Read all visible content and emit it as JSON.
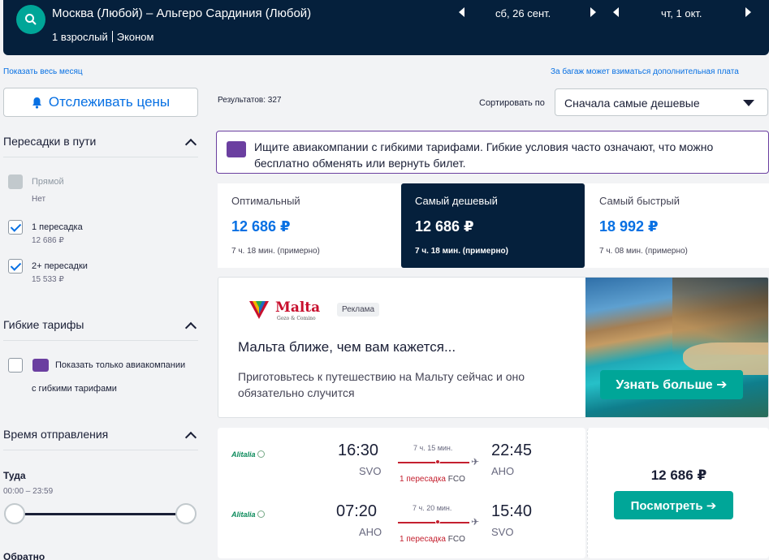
{
  "header": {
    "route": "Москва (Любой) – Альгеро Сардиния (Любой)",
    "passengers": "1 взрослый",
    "cabin": "Эконом",
    "depart_date": "сб, 26 сент.",
    "return_date": "чт, 1 окт."
  },
  "links": {
    "whole_month": "Показать весь месяц",
    "baggage": "За багаж может взиматься дополнительная плата"
  },
  "sidebar": {
    "track_label": "Отслеживать цены",
    "stops": {
      "title": "Пересадки в пути",
      "options": [
        {
          "label": "Прямой",
          "sub": "Нет",
          "checked": false,
          "disabled": true
        },
        {
          "label": "1 пересадка",
          "sub": "12 686 ₽",
          "checked": true,
          "disabled": false
        },
        {
          "label": "2+ пересадки",
          "sub": "15 533 ₽",
          "checked": true,
          "disabled": false
        }
      ]
    },
    "flex": {
      "title": "Гибкие тарифы",
      "option_line1": "Показать только авиакомпании",
      "option_line2": "с гибкими тарифами"
    },
    "departure": {
      "title": "Время отправления",
      "outbound_label": "Туда",
      "outbound_range": "00:00 – 23:59",
      "return_label": "Обратно"
    }
  },
  "main": {
    "results": "Результатов: 327",
    "sort_label": "Сортировать по",
    "sort_value": "Сначала самые дешевые",
    "flex_banner": "Ищите авиакомпании с гибкими тарифами. Гибкие условия часто означают, что можно бесплатно обменять или вернуть билет.",
    "tabs": [
      {
        "label": "Оптимальный",
        "price": "12 686 ₽",
        "time": "7 ч. 18 мин. (примерно)",
        "active": false
      },
      {
        "label": "Самый дешевый",
        "price": "12 686 ₽",
        "time": "7 ч. 18 мин. (примерно)",
        "active": true
      },
      {
        "label": "Самый быстрый",
        "price": "18 992 ₽",
        "time": "7 ч. 08 мин. (примерно)",
        "active": false
      }
    ],
    "ad": {
      "brand": "Malta",
      "brand_sub": "Gozo & Comino",
      "badge": "Реклама",
      "headline": "Мальта ближе, чем вам кажется...",
      "desc": "Приготовьтесь к путешествию на Мальту сейчас и оно обязательно случится",
      "cta": "Узнать больше ➔"
    },
    "ticket": {
      "price": "12 686 ₽",
      "button": "Посмотреть ➔",
      "legs": [
        {
          "airline": "Alitalia",
          "dep_time": "16:30",
          "dep_code": "SVO",
          "duration": "7 ч. 15 мин.",
          "stops": "1 пересадка",
          "via": "FCO",
          "arr_time": "22:45",
          "arr_code": "AHO"
        },
        {
          "airline": "Alitalia",
          "dep_time": "07:20",
          "dep_code": "AHO",
          "duration": "7 ч. 20 мин.",
          "stops": "1 пересадка",
          "via": "FCO",
          "arr_time": "15:40",
          "arr_code": "SVO"
        }
      ]
    }
  },
  "colors": {
    "navy": "#05203c",
    "accent": "#00a698",
    "link": "#0770e3",
    "stop_red": "#c4202f",
    "flex_purple": "#6b3fa0"
  }
}
